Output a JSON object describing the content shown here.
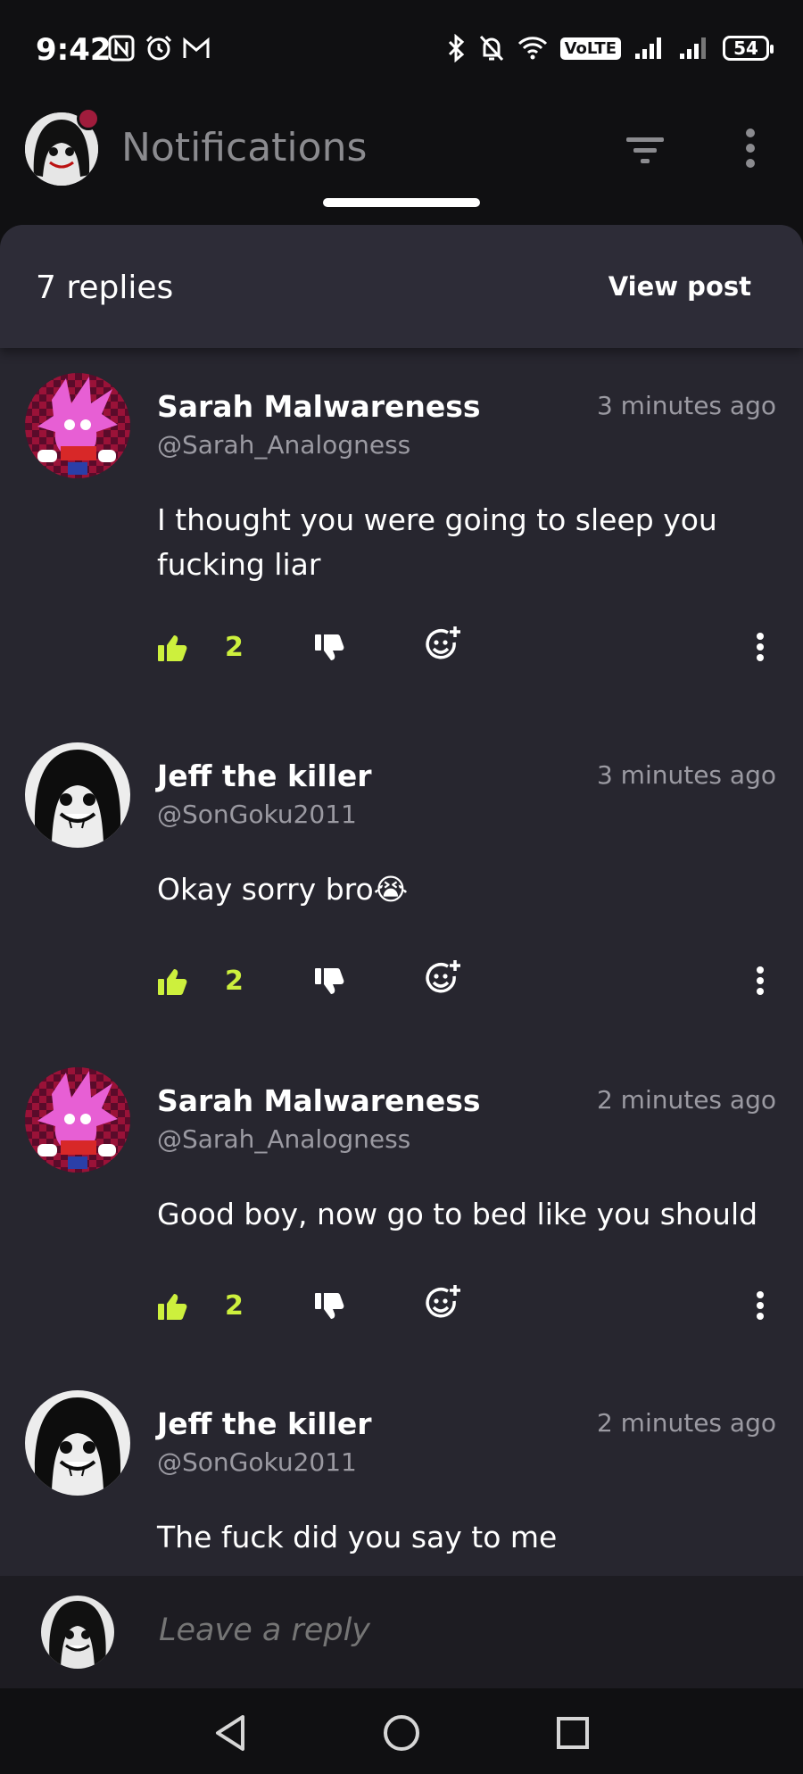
{
  "status_bar": {
    "time": "9:42",
    "left_icons": [
      "nfc-icon",
      "alarm-icon",
      "gmail-icon"
    ],
    "right_icons": [
      "bluetooth-icon",
      "mute-icon",
      "wifi-icon",
      "volte-badge",
      "signal-icon",
      "signal-icon"
    ],
    "volte": "VoLTE",
    "battery": "54"
  },
  "app_bar": {
    "title": "Notifications",
    "filter_icon": "filter-icon",
    "more_icon": "more-vertical-icon"
  },
  "sheet": {
    "replies_count": "7 replies",
    "view_post": "View post"
  },
  "comments": [
    {
      "author": "Sarah Malwareness",
      "handle": "@Sarah_Analogness",
      "time": "3 minutes ago",
      "body": "I thought you were going to sleep you fucking liar",
      "likes": "2",
      "avatar": "pink-hedgehog-avatar"
    },
    {
      "author": "Jeff the killer",
      "handle": "@SonGoku2011",
      "time": "3 minutes ago",
      "body": "Okay sorry bro😭",
      "likes": "2",
      "avatar": "jeff-avatar"
    },
    {
      "author": "Sarah Malwareness",
      "handle": "@Sarah_Analogness",
      "time": "2 minutes ago",
      "body": "Good boy, now go to bed like you should",
      "likes": "2",
      "avatar": "pink-hedgehog-avatar"
    },
    {
      "author": "Jeff the killer",
      "handle": "@SonGoku2011",
      "time": "2 minutes ago",
      "body": "The fuck did you say to me",
      "likes": "",
      "avatar": "jeff-avatar"
    }
  ],
  "reply_bar": {
    "placeholder": "Leave a reply"
  },
  "nav_bar": {
    "back_icon": "back-triangle-icon",
    "home_icon": "home-circle-icon",
    "recents_icon": "recents-square-icon"
  },
  "colors": {
    "accent_like": "#cdf03d",
    "sheet_bg": "#27262f",
    "header_bg": "#2d2c37",
    "notif_dot": "#a01c3c"
  }
}
